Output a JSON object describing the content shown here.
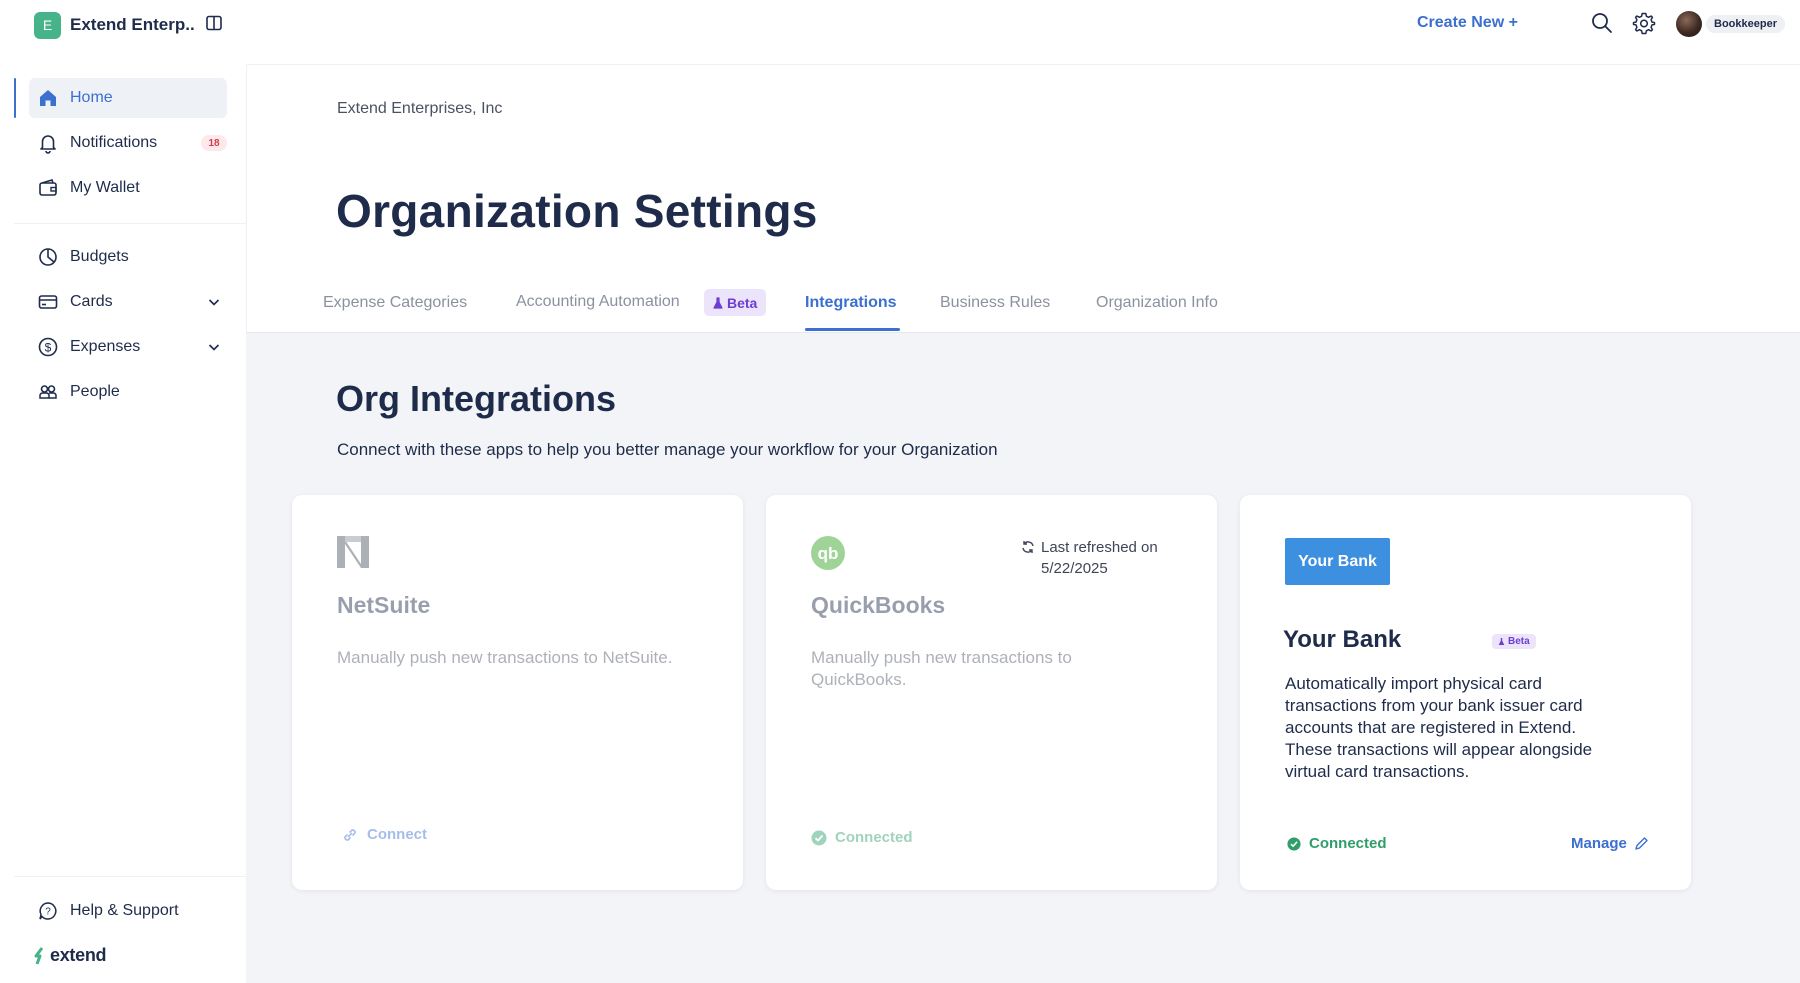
{
  "brand": {
    "initial": "E",
    "name": "Extend Enterp..."
  },
  "sidebar": {
    "items": [
      {
        "label": "Home"
      },
      {
        "label": "Notifications",
        "badge": "18"
      },
      {
        "label": "My Wallet"
      },
      {
        "label": "Budgets"
      },
      {
        "label": "Cards"
      },
      {
        "label": "Expenses"
      },
      {
        "label": "People"
      }
    ],
    "help_label": "Help & Support",
    "logo_text": "extend"
  },
  "topbar": {
    "create_new": "Create New +",
    "user_role": "Bookkeeper"
  },
  "header": {
    "org_name": "Extend Enterprises, Inc",
    "title": "Organization Settings"
  },
  "tabs": [
    {
      "label": "Expense Categories"
    },
    {
      "label": "Accounting Automation",
      "badge": "Beta"
    },
    {
      "label": "Integrations",
      "active": true
    },
    {
      "label": "Business Rules"
    },
    {
      "label": "Organization Info"
    }
  ],
  "section": {
    "title": "Org Integrations",
    "description": "Connect with these apps to help you better manage your workflow for your Organization"
  },
  "cards": [
    {
      "name": "NetSuite",
      "description": "Manually push new transactions to NetSuite.",
      "action": "Connect"
    },
    {
      "name": "QuickBooks",
      "description": "Manually push new transactions to QuickBooks.",
      "status": "Connected",
      "refresh_label": "Last refreshed on",
      "refresh_date": "5/22/2025"
    },
    {
      "logo_label": "Your Bank",
      "name": "Your Bank",
      "badge": "Beta",
      "description": "Automatically import physical card transactions from your bank issuer card accounts that are registered in Extend. These transactions will appear alongside virtual card transactions.",
      "status": "Connected",
      "manage": "Manage"
    }
  ],
  "colors": {
    "accent": "#3b6fd0",
    "success": "#2f9e6a",
    "beta": "#6d3fd1",
    "brand": "#46b38a"
  }
}
